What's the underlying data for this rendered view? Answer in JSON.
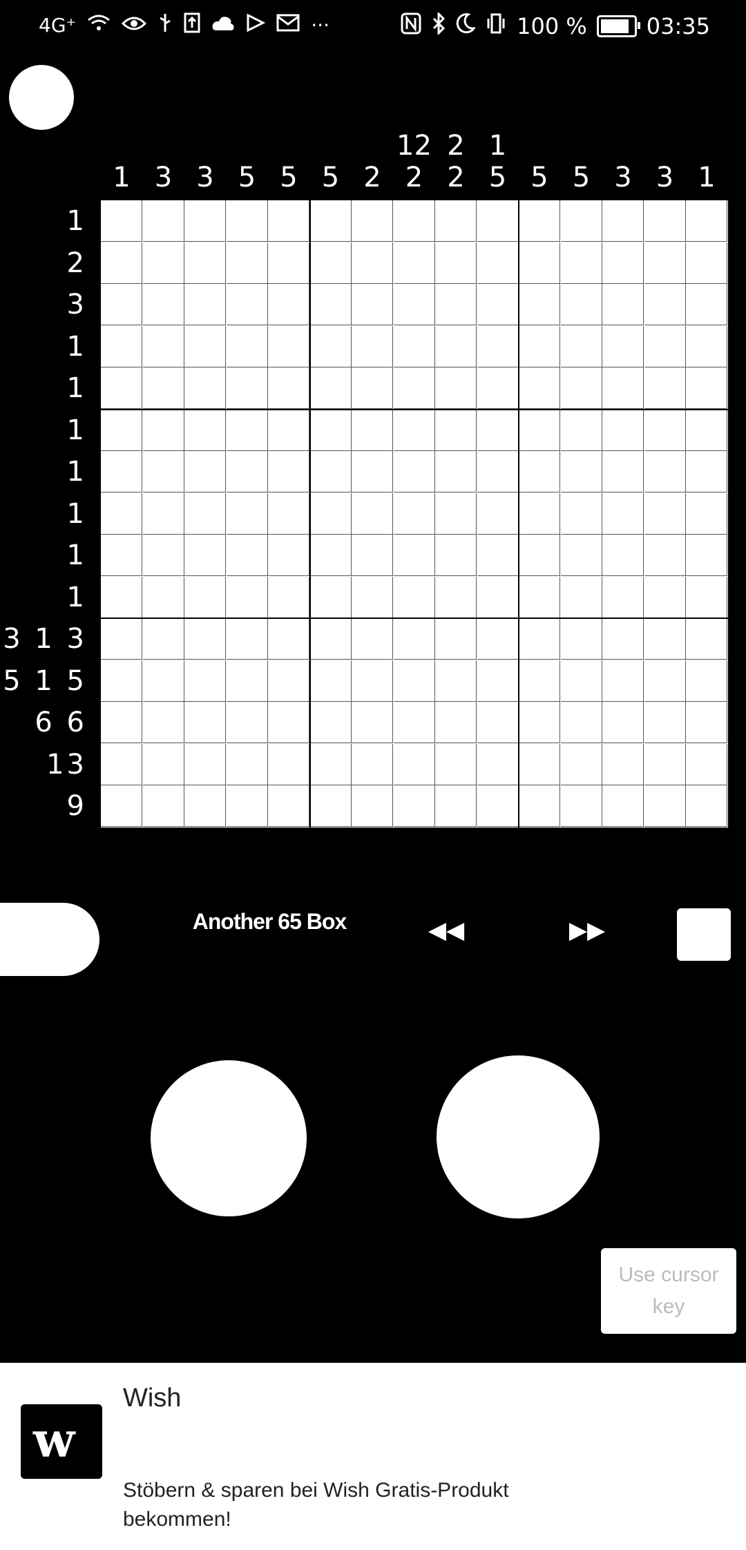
{
  "status_bar": {
    "left_icons": [
      "network-4g-icon",
      "wifi-icon",
      "eye-icon",
      "usb-icon",
      "upload-icon",
      "cloud-icon",
      "play-store-icon",
      "mail-icon",
      "more-icon"
    ],
    "network_label": "4G⁺",
    "more_label": "···",
    "battery_percent": "100 %",
    "battery_level": 1.0,
    "time": "03:35"
  },
  "puzzle": {
    "title": "Another 65 Box",
    "column_clues": [
      [
        "1"
      ],
      [
        "3"
      ],
      [
        "3"
      ],
      [
        "5"
      ],
      [
        "5"
      ],
      [
        "5"
      ],
      [
        "2"
      ],
      [
        "12",
        "2"
      ],
      [
        "2",
        "2"
      ],
      [
        "1",
        "5"
      ],
      [
        "5"
      ],
      [
        "5"
      ],
      [
        "3"
      ],
      [
        "3"
      ],
      [
        "1"
      ]
    ],
    "row_clues": [
      "1",
      "2",
      "3",
      "1",
      "1",
      "1",
      "1",
      "1",
      "1",
      "1",
      "3 1 3",
      "5 1 5",
      "6 6",
      "13",
      "9"
    ],
    "rows": 15,
    "cols": 15
  },
  "controls": {
    "prev_label": "◀◀",
    "next_label": "▶▶",
    "cursor_key_label": "Use cursor key"
  },
  "ad": {
    "title": "Wish",
    "logo_text": "w",
    "text": "Stöbern & sparen bei Wish Gratis-Produkt bekommen!"
  }
}
